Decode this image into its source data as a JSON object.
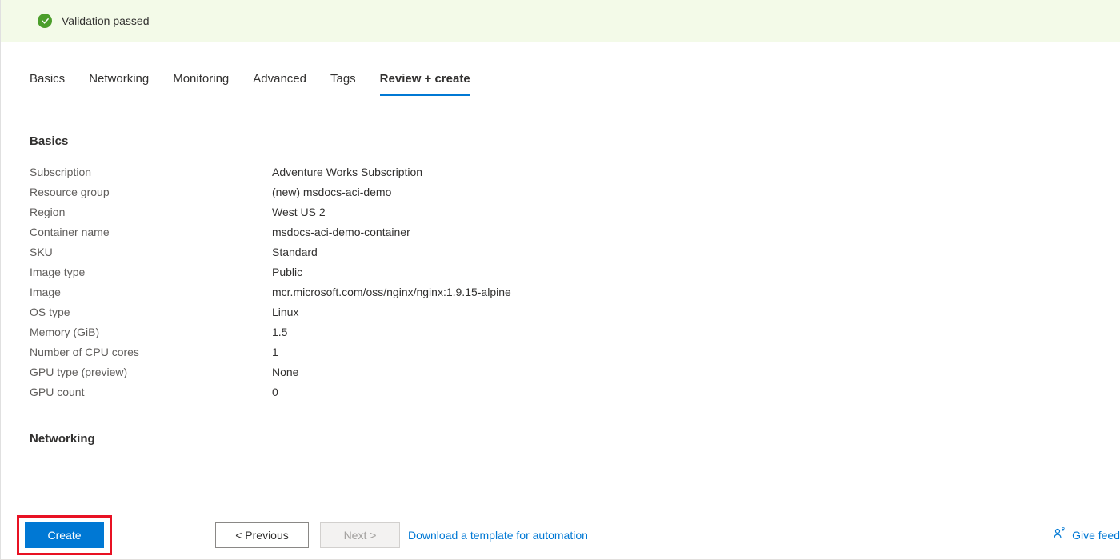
{
  "validation": {
    "message": "Validation passed"
  },
  "tabs": {
    "basics": "Basics",
    "networking": "Networking",
    "monitoring": "Monitoring",
    "advanced": "Advanced",
    "tags": "Tags",
    "review": "Review + create"
  },
  "sections": {
    "basics": {
      "title": "Basics",
      "rows": {
        "subscription_k": "Subscription",
        "subscription_v": "Adventure Works Subscription",
        "rg_k": "Resource group",
        "rg_v": "(new) msdocs-aci-demo",
        "region_k": "Region",
        "region_v": "West US 2",
        "cname_k": "Container name",
        "cname_v": "msdocs-aci-demo-container",
        "sku_k": "SKU",
        "sku_v": "Standard",
        "imgtype_k": "Image type",
        "imgtype_v": "Public",
        "img_k": "Image",
        "img_v": "mcr.microsoft.com/oss/nginx/nginx:1.9.15-alpine",
        "os_k": "OS type",
        "os_v": "Linux",
        "mem_k": "Memory (GiB)",
        "mem_v": "1.5",
        "cpu_k": "Number of CPU cores",
        "cpu_v": "1",
        "gputype_k": "GPU type (preview)",
        "gputype_v": "None",
        "gpucount_k": "GPU count",
        "gpucount_v": "0"
      }
    },
    "networking": {
      "title": "Networking"
    }
  },
  "footer": {
    "create": "Create",
    "previous": "< Previous",
    "next": "Next >",
    "download": "Download a template for automation",
    "feedback": "Give feed"
  }
}
